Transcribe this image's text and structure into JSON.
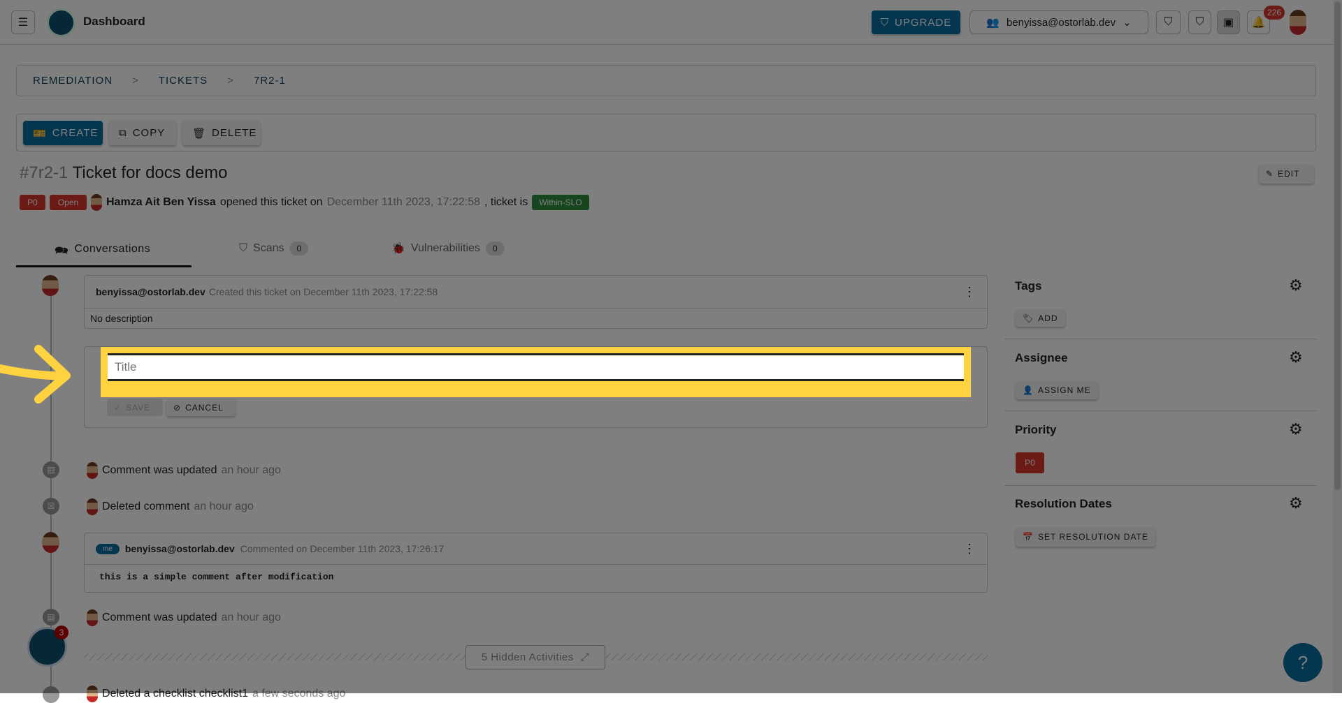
{
  "header": {
    "title": "Dashboard",
    "upgrade": "UPGRADE",
    "account": "benyissa@ostorlab.dev",
    "notifications": "226"
  },
  "breadcrumb": [
    "REMEDIATION",
    "TICKETS",
    "7R2-1"
  ],
  "toolbar": {
    "create": "CREATE",
    "copy": "COPY",
    "delete": "DELETE"
  },
  "ticket": {
    "id": "#7r2-1",
    "title": "Ticket for docs demo",
    "edit": "EDIT",
    "priority": "P0",
    "status": "Open",
    "author": "Hamza Ait Ben Yissa",
    "opened_text": "opened this ticket on",
    "opened_date": "December 11th 2023, 17:22:58",
    "ticket_is": ", ticket is",
    "slo": "Within-SLO"
  },
  "tabs": [
    {
      "label": "Conversations"
    },
    {
      "label": "Scans",
      "count": "0"
    },
    {
      "label": "Vulnerabilities",
      "count": "0"
    }
  ],
  "timeline": {
    "card1": {
      "user": "benyissa@ostorlab.dev",
      "meta": "Created this ticket on December 11th 2023, 17:22:58",
      "body": "No description"
    },
    "edit": {
      "placeholder": "Title",
      "save": "SAVE",
      "cancel": "CANCEL"
    },
    "act1": {
      "text": "Comment was updated",
      "time": "an hour ago"
    },
    "act2": {
      "text": "Deleted comment",
      "time": "an hour ago"
    },
    "card2": {
      "tag": "me",
      "user": "benyissa@ostorlab.dev",
      "meta": "Commented on December 11th 2023, 17:26:17",
      "body": "this is a simple comment after modification"
    },
    "act3": {
      "text": "Comment was updated",
      "time": "an hour ago"
    },
    "hidden": "5 Hidden Activities",
    "act4": {
      "text": "Deleted a checklist checklist1",
      "time": "a few seconds ago"
    }
  },
  "fab_badge": "3",
  "help": "?",
  "side": {
    "tags": "Tags",
    "add": "ADD",
    "assignee": "Assignee",
    "assign_me": "ASSIGN ME",
    "priority": "Priority",
    "priority_value": "P0",
    "resolution": "Resolution Dates",
    "set_date": "SET RESOLUTION DATE"
  },
  "colors": {
    "accent": "#0a6c9e",
    "danger": "#d8342c",
    "success": "#2e8b3a",
    "highlight": "#ffd23f"
  }
}
